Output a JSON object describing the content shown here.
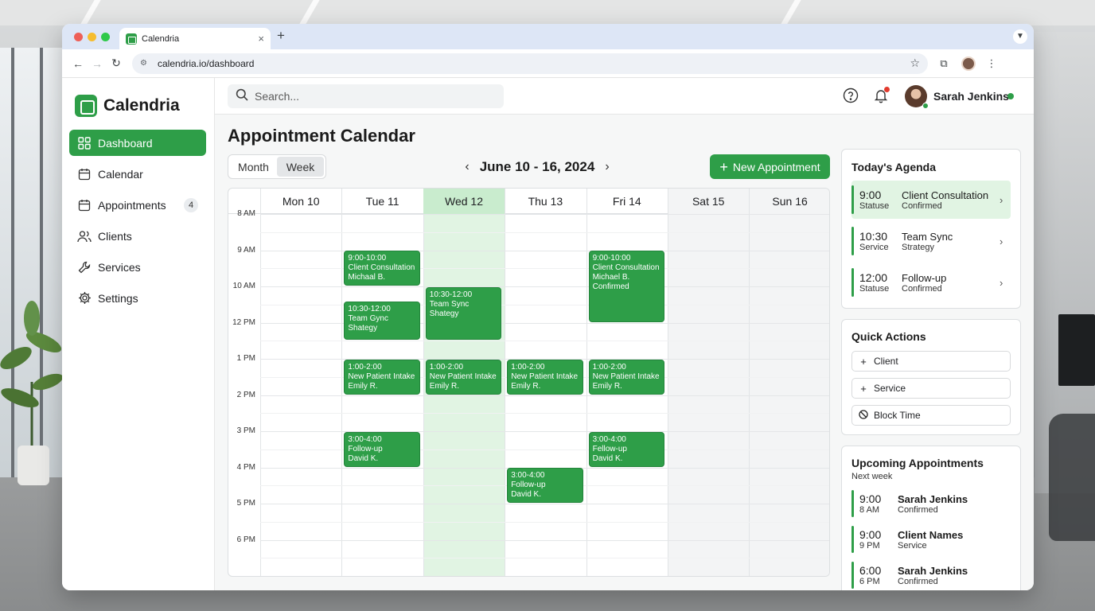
{
  "browser": {
    "tab_title": "Calendria",
    "tab_close": "×",
    "new_tab": "+",
    "url": "calendria.io/dashboard"
  },
  "app": {
    "name": "Calendria",
    "accent_color": "#2e9e48"
  },
  "sidebar": {
    "items": [
      {
        "label": "Dashboard",
        "icon": "dashboard-icon",
        "active": true
      },
      {
        "label": "Calendar",
        "icon": "calendar-icon"
      },
      {
        "label": "Appointments",
        "icon": "appointments-icon",
        "badge": "4"
      },
      {
        "label": "Clients",
        "icon": "clients-icon"
      },
      {
        "label": "Services",
        "icon": "wrench-icon"
      },
      {
        "label": "Settings",
        "icon": "gear-icon"
      }
    ]
  },
  "topbar": {
    "search_placeholder": "Search...",
    "user_name": "Sarah Jenkins"
  },
  "calendar": {
    "title": "Appointment Calendar",
    "views": [
      "Month",
      "Week"
    ],
    "active_view": "Week",
    "week_label": "June 10 - 16, 2024",
    "new_button": "New Appointment",
    "days": [
      "Mon 10",
      "Tue 11",
      "Wed 12",
      "Thu 13",
      "Fri 14",
      "Sat 15",
      "Sun 16"
    ],
    "hours": [
      "8 AM",
      "9 AM",
      "10 AM",
      "12 PM",
      "1 PM",
      "2 PM",
      "3 PM",
      "4 PM",
      "5 PM",
      "6 PM"
    ],
    "events": [
      {
        "day": 1,
        "start": 9.0,
        "end": 10.0,
        "lines": [
          "9:00-10:00",
          "Client Consultation",
          "Michaal B."
        ]
      },
      {
        "day": 1,
        "start": 10.4,
        "end": 11.5,
        "lines": [
          "10:30-12:00",
          "Team Gync",
          "Shategy"
        ]
      },
      {
        "day": 1,
        "start": 13.0,
        "end": 14.0,
        "lines": [
          "1:00-2:00",
          "New Patient Intake",
          "Emily R."
        ]
      },
      {
        "day": 1,
        "start": 15.0,
        "end": 16.0,
        "lines": [
          "3:00-4:00",
          "Follow-up",
          "David K."
        ]
      },
      {
        "day": 2,
        "start": 10.0,
        "end": 11.5,
        "lines": [
          "10:30-12:00",
          "Team Sync",
          "Shategy"
        ]
      },
      {
        "day": 2,
        "start": 13.0,
        "end": 14.0,
        "lines": [
          "1:00-2:00",
          "New Patient Intake",
          "Emily R."
        ]
      },
      {
        "day": 3,
        "start": 13.0,
        "end": 14.0,
        "lines": [
          "1:00-2:00",
          "New Patient Intake",
          "Emily R."
        ]
      },
      {
        "day": 3,
        "start": 16.0,
        "end": 17.0,
        "lines": [
          "3:00-4:00",
          "Follow-up",
          "David K."
        ]
      },
      {
        "day": 4,
        "start": 9.0,
        "end": 11.0,
        "lines": [
          "9:00-10:00",
          "Client Consultation",
          "Michael B.",
          "Confirmed"
        ]
      },
      {
        "day": 4,
        "start": 13.0,
        "end": 14.0,
        "lines": [
          "1:00-2:00",
          "New Patient Intake",
          "Emily R."
        ]
      },
      {
        "day": 4,
        "start": 15.0,
        "end": 16.0,
        "lines": [
          "3:00-4:00",
          "Fellow-up",
          "David K."
        ]
      }
    ]
  },
  "agenda": {
    "title": "Today's Agenda",
    "items": [
      {
        "time": "9:00",
        "sub": "Statuse",
        "title": "Client Consultation",
        "status": "Confirmed",
        "highlight": true
      },
      {
        "time": "10:30",
        "sub": "Service",
        "title": "Team Sync",
        "status": "Strategy"
      },
      {
        "time": "12:00",
        "sub": "Statuse",
        "title": "Follow-up",
        "status": "Confirmed"
      }
    ]
  },
  "quick_actions": {
    "title": "Quick Actions",
    "items": [
      {
        "label": "Client",
        "icon": "plus-icon"
      },
      {
        "label": "Service",
        "icon": "plus-icon"
      },
      {
        "label": "Block Time",
        "icon": "block-icon"
      }
    ]
  },
  "upcoming": {
    "title": "Upcoming Appointments",
    "subtitle": "Next week",
    "items": [
      {
        "time": "9:00",
        "sub": "8 AM",
        "name": "Sarah Jenkins",
        "status": "Confirmed"
      },
      {
        "time": "9:00",
        "sub": "9 PM",
        "name": "Client Names",
        "status": "Service"
      },
      {
        "time": "6:00",
        "sub": "6 PM",
        "name": "Sarah Jenkins",
        "status": "Confirmed"
      }
    ]
  }
}
